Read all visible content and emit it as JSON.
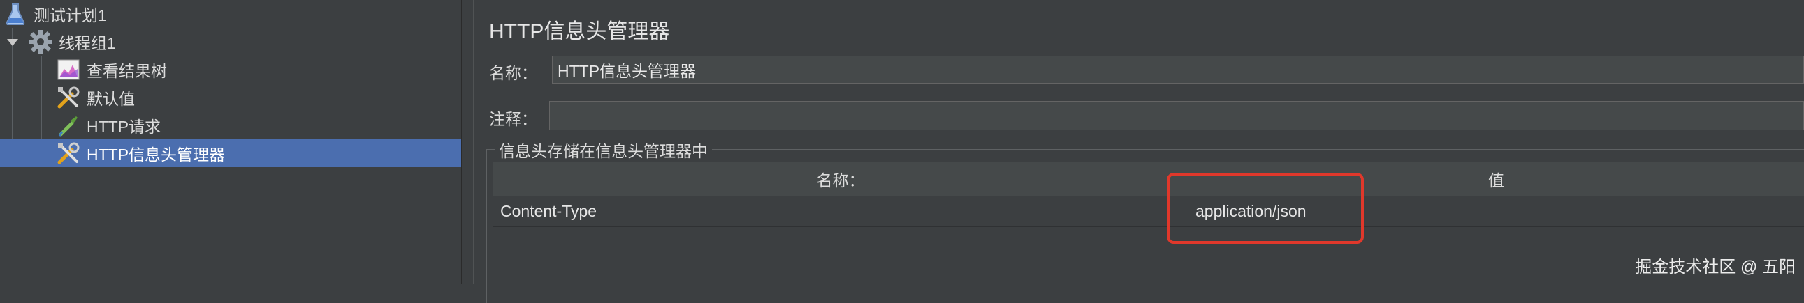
{
  "tree": {
    "items": [
      {
        "label": "测试计划1",
        "icon": "flask-icon"
      },
      {
        "label": "线程组1",
        "icon": "gear-icon"
      },
      {
        "label": "查看结果树",
        "icon": "chart-icon"
      },
      {
        "label": "默认值",
        "icon": "tools-icon"
      },
      {
        "label": "HTTP请求",
        "icon": "pipette-icon"
      },
      {
        "label": "HTTP信息头管理器",
        "icon": "tools-icon"
      }
    ]
  },
  "panel": {
    "title": "HTTP信息头管理器",
    "name_label": "名称：",
    "name_value": "HTTP信息头管理器",
    "comment_label": "注释：",
    "comment_value": "",
    "group_title": "信息头存储在信息头管理器中",
    "table": {
      "columns": [
        "名称：",
        "值"
      ],
      "rows": [
        {
          "name": "Content-Type",
          "value": "application/json"
        }
      ]
    }
  },
  "watermark": "掘金技术社区 @ 五阳",
  "colors": {
    "selection": "#4b6eaf",
    "highlight": "#e0382b",
    "background": "#3c3f41"
  }
}
